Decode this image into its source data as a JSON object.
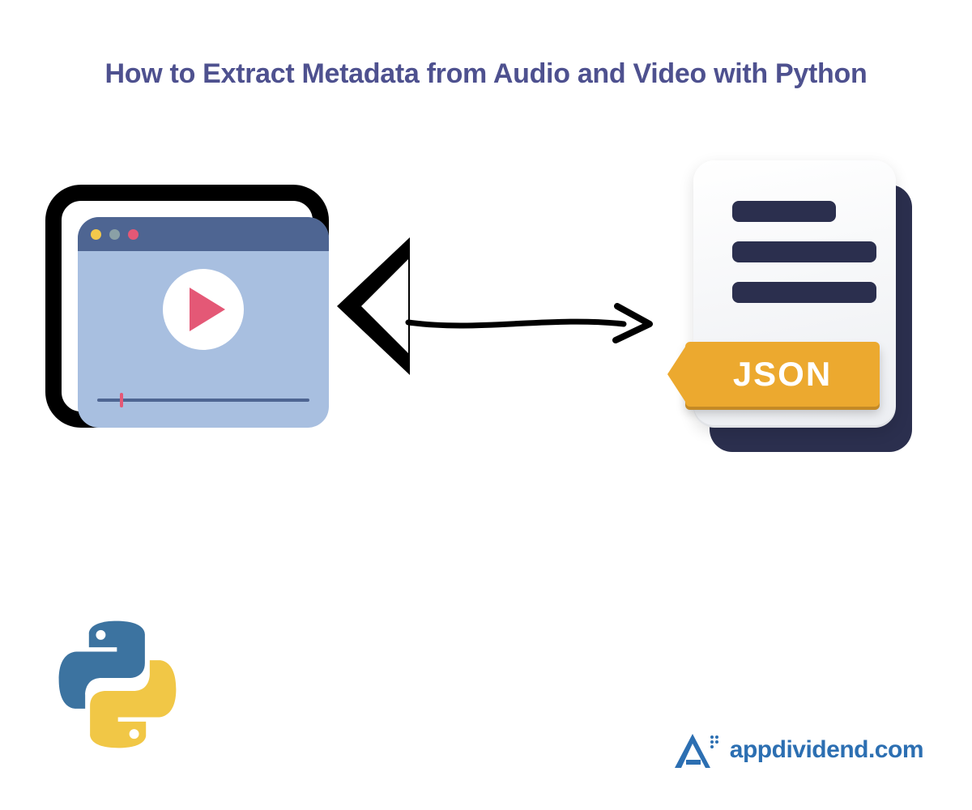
{
  "title": "How to Extract Metadata from Audio and Video with Python",
  "json_label": "JSON",
  "brand": "appdividend.com",
  "icons": {
    "camera": "video-camera-icon",
    "play": "play-icon",
    "json_doc": "json-document-icon",
    "python": "python-logo-icon",
    "arrow": "arrow-right-icon",
    "brand_mark": "appdividend-logo-icon"
  },
  "colors": {
    "title": "#4e518f",
    "screen_bg": "#a8bfe0",
    "titlebar": "#4e6592",
    "play": "#e45876",
    "doc_dark": "#2b2f4e",
    "badge": "#eca92f",
    "brand_blue": "#2c6fb2",
    "python_blue": "#3c73a0",
    "python_yellow": "#f1c746"
  }
}
